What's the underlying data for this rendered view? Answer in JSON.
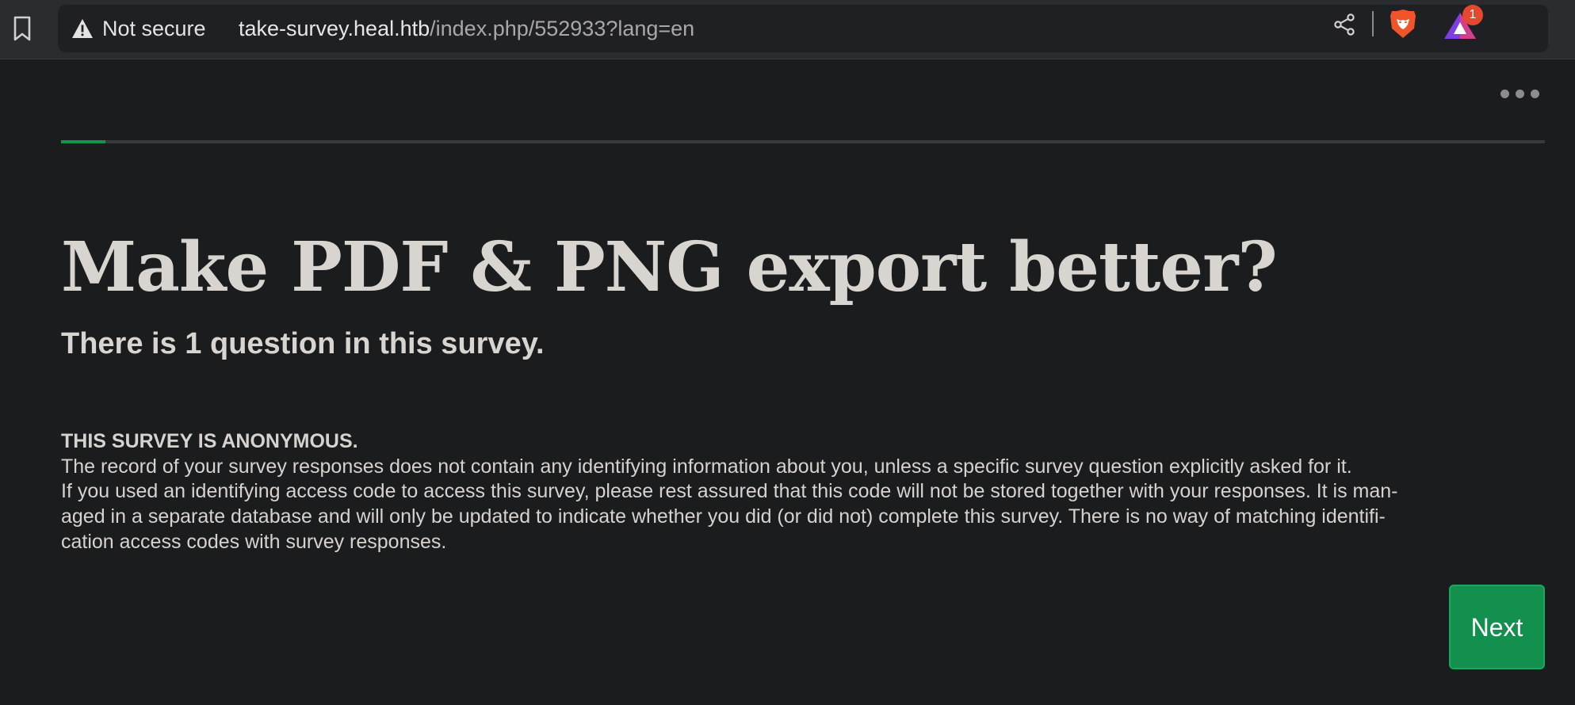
{
  "browser": {
    "security_label": "Not secure",
    "url_host": "take-survey.heal.htb",
    "url_path": "/index.php/552933?lang=en",
    "rewards_badge_count": "1",
    "colors": {
      "brave_lion": "#f0542a",
      "rewards_triangle": "#7b3fe4",
      "badge": "#e5472f"
    }
  },
  "survey": {
    "progress_fraction": 0.03,
    "title": "Make PDF & PNG export better?",
    "question_count_text": "There is 1 question in this survey.",
    "privacy": {
      "heading": "THIS SURVEY IS ANONYMOUS.",
      "line1": "The record of your survey responses does not contain any identifying information about you, unless a specific survey question explicitly asked for it.",
      "line2": "If you used an identifying access code to access this survey, please rest assured that this code will not be stored together with your responses. It is man-",
      "line3": "aged in a separate database and will only be updated to indicate whether you did (or did not) complete this survey. There is no way of matching identifi-",
      "line4": "cation access codes with survey responses."
    },
    "next_label": "Next",
    "colors": {
      "accent": "#13904d",
      "background": "#1b1c1e",
      "text": "#d8d5d1"
    }
  }
}
